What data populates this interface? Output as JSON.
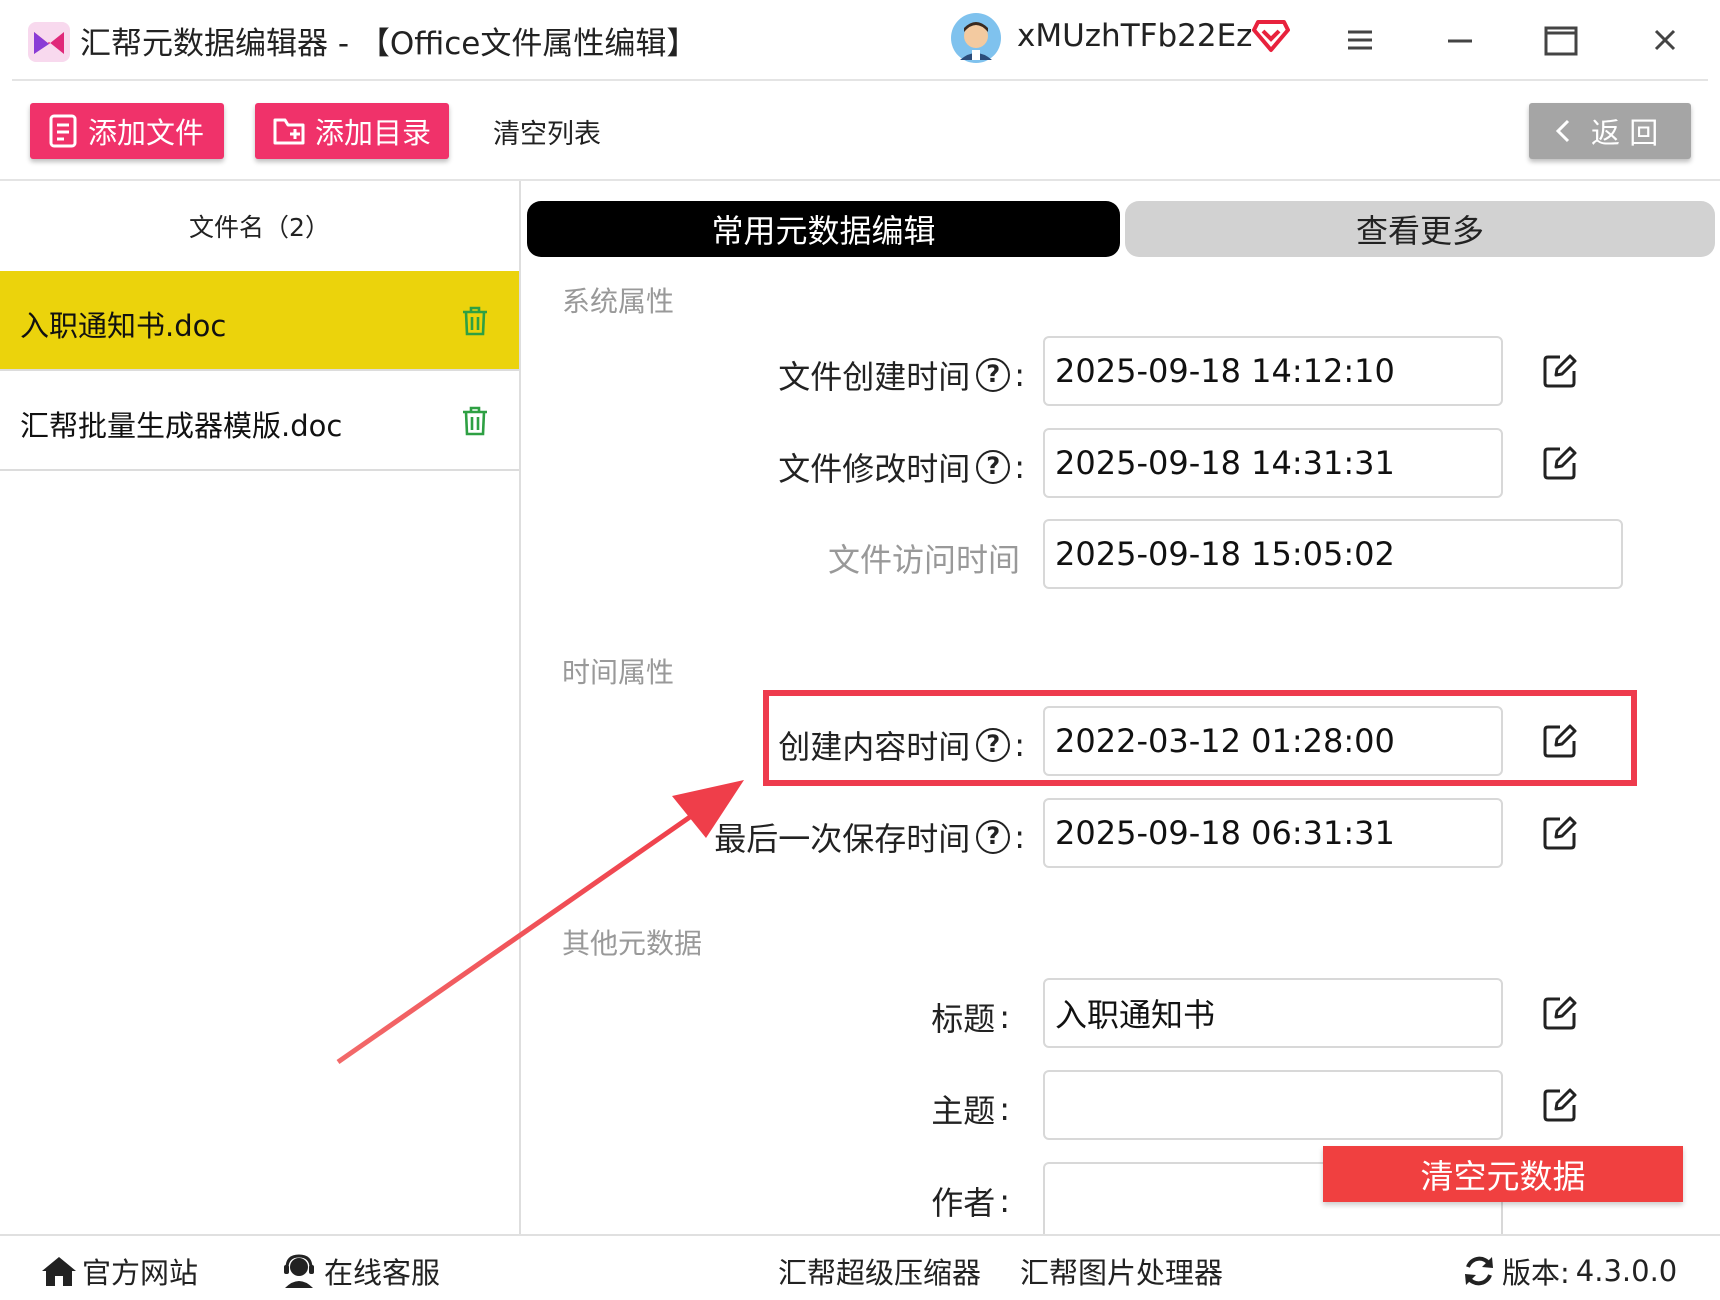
{
  "window": {
    "title": "汇帮元数据编辑器 - 【Office文件属性编辑】",
    "username": "xMUzhTFb22Ez",
    "icons": [
      "app-logo-icon",
      "avatar",
      "vip-diamond-icon",
      "menu-icon",
      "minimize-icon",
      "maximize-icon",
      "close-icon"
    ]
  },
  "toolbar": {
    "add_file": "添加文件",
    "add_folder": "添加目录",
    "clear_list": "清空列表",
    "back": "返 回"
  },
  "file_list": {
    "header": "文件名（2）",
    "items": [
      {
        "name": "入职通知书.doc",
        "selected": true
      },
      {
        "name": "汇帮批量生成器模版.doc",
        "selected": false
      }
    ]
  },
  "tabs": [
    {
      "label": "常用元数据编辑",
      "active": true
    },
    {
      "label": "查看更多",
      "active": false
    }
  ],
  "sections": {
    "system": {
      "title": "系统属性",
      "fields": [
        {
          "label": "文件创建时间",
          "value": "2025-09-18 14:12:10"
        },
        {
          "label": "文件修改时间",
          "value": "2025-09-18 14:31:31"
        },
        {
          "label": "文件访问时间",
          "value": "2025-09-18 15:05:02"
        }
      ]
    },
    "time": {
      "title": "时间属性",
      "fields": [
        {
          "label": "创建内容时间",
          "value": "2022-03-12 01:28:00"
        },
        {
          "label": "最后一次保存时间",
          "value": "2025-09-18 06:31:31"
        }
      ]
    },
    "other": {
      "title": "其他元数据",
      "fields": [
        {
          "label": "标题",
          "value": "入职通知书"
        },
        {
          "label": "主题",
          "value": ""
        },
        {
          "label": "作者",
          "value": ""
        }
      ]
    }
  },
  "clear_metadata": "清空元数据",
  "statusbar": {
    "website": "官方网站",
    "support": "在线客服",
    "compressor": "汇帮超级压缩器",
    "image_tool": "汇帮图片处理器",
    "version_label": "版本:",
    "version": "4.3.0.0"
  },
  "colors": {
    "accent_pink": "#f0326a",
    "selected_row": "#ebd30c",
    "highlight_red": "#ee3b4d",
    "clear_button": "#f04040"
  }
}
